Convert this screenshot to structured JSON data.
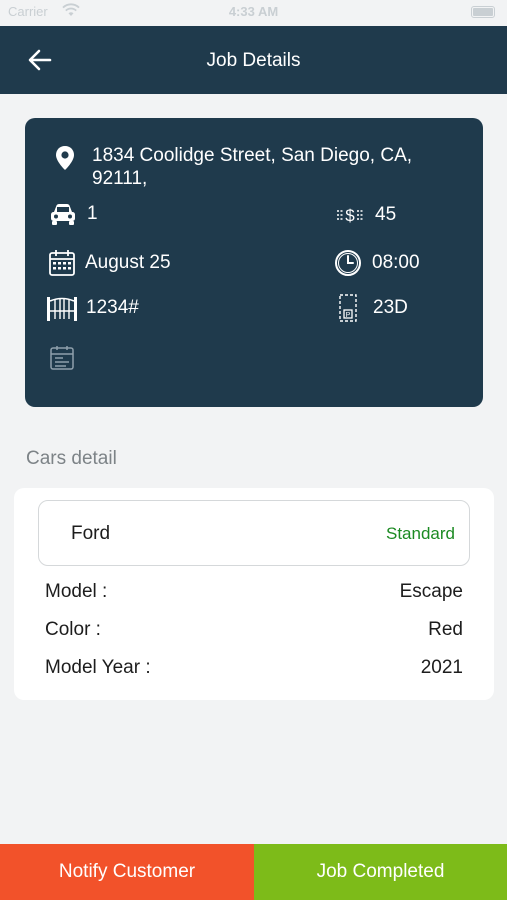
{
  "status_bar": {
    "carrier": "Carrier",
    "time": "4:33 AM"
  },
  "header": {
    "title": "Job Details"
  },
  "job": {
    "address_line1": "1834 Coolidge Street, San Diego, CA,",
    "address_line2": "92111,",
    "cars_count": "1",
    "price": "45",
    "date": "August 25",
    "time": "08:00",
    "gate_code": "1234#",
    "parking_spot": "23D",
    "icons": [
      "location-pin-icon",
      "car-icon",
      "dollar-arrows-icon",
      "calendar-icon",
      "clock-icon",
      "gate-icon",
      "parking-icon",
      "calendar-note-icon"
    ]
  },
  "cars_section": {
    "title": "Cars detail"
  },
  "car": {
    "make": "Ford",
    "service_type": "Standard",
    "details": [
      {
        "label": "Model :",
        "value": "Escape"
      },
      {
        "label": "Color :",
        "value": "Red"
      },
      {
        "label": "Model Year :",
        "value": "2021"
      }
    ]
  },
  "actions": {
    "notify_label": "Notify Customer",
    "complete_label": "Job Completed"
  },
  "colors": {
    "header_bg": "#1f3a4c",
    "notify_bg": "#f2522a",
    "complete_bg": "#7dbb19",
    "standard_text": "#1b8a22"
  }
}
